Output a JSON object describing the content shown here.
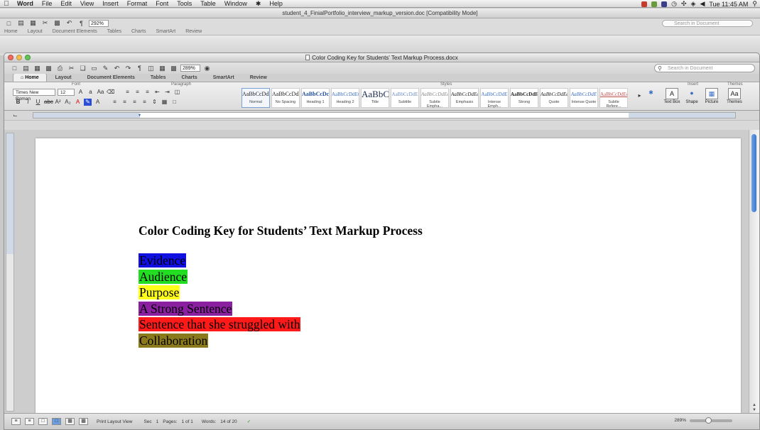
{
  "menubar": {
    "app": "Word",
    "items": [
      "File",
      "Edit",
      "View",
      "Insert",
      "Format",
      "Font",
      "Tools",
      "Table",
      "Window",
      "Help"
    ],
    "clock": "Tue 11:45 AM"
  },
  "background_window": {
    "title": "student_4_FinialPortfolio_interview_markup_version.doc [Compatibility Mode]",
    "zoom": "292%",
    "search_placeholder": "Search in Document",
    "tabs": [
      "Home",
      "Layout",
      "Document Elements",
      "Tables",
      "Charts",
      "SmartArt",
      "Review"
    ]
  },
  "window": {
    "title": "Color Coding Key for Students' Text Markup Process.docx",
    "zoom": "289%",
    "search_placeholder": "Search in Document",
    "tabs": [
      "Home",
      "Layout",
      "Document Elements",
      "Tables",
      "Charts",
      "SmartArt",
      "Review"
    ]
  },
  "ribbon": {
    "groups": {
      "font": "Font",
      "paragraph": "Paragraph",
      "styles": "Styles",
      "insert": "Insert",
      "themes": "Themes"
    },
    "font_name": "Times New Roman",
    "font_size": "12",
    "styles": [
      {
        "sample": "AaBbCcDdE",
        "name": "Normal"
      },
      {
        "sample": "AaBbCcDdE",
        "name": "No Spacing"
      },
      {
        "sample": "AaBbCcDc",
        "name": "Heading 1"
      },
      {
        "sample": "AaBbCcDdEt",
        "name": "Heading 2"
      },
      {
        "sample": "AaBbC",
        "name": "Title"
      },
      {
        "sample": "AaBbCcDdE",
        "name": "Subtitle"
      },
      {
        "sample": "AaBbCcDdEe",
        "name": "Subtle Empha..."
      },
      {
        "sample": "AaBbCcDdEe",
        "name": "Emphasis"
      },
      {
        "sample": "AaBbCcDdE",
        "name": "Intense Emph..."
      },
      {
        "sample": "AaBbCcDdE",
        "name": "Strong"
      },
      {
        "sample": "AaBbCcDdEe",
        "name": "Quote"
      },
      {
        "sample": "AaBbCcDdE",
        "name": "Intense Quote"
      },
      {
        "sample": "AaBbCcDdEe",
        "name": "Subtle Refere..."
      }
    ],
    "insert": [
      "Text Box",
      "Shape",
      "Picture"
    ],
    "themes": "Themes"
  },
  "document": {
    "title": "Color Coding Key for Students’ Text Markup Process",
    "key": [
      {
        "label": "Evidence",
        "color": "#1010e0"
      },
      {
        "label": "Audience",
        "color": "#22dd22"
      },
      {
        "label": "Purpose",
        "color": "#ffff1a"
      },
      {
        "label": "A Strong Sentence",
        "color": "#8a1fa0"
      },
      {
        "label": "Sentence that she struggled with",
        "color": "#ff1a1a"
      },
      {
        "label": "Collaboration",
        "color": "#8a7a1c"
      }
    ]
  },
  "statusbar": {
    "view": "Print Layout View",
    "sec_label": "Sec",
    "sec": "1",
    "pages_label": "Pages:",
    "pages": "1 of 1",
    "words_label": "Words:",
    "words": "14 of 20",
    "zoom": "289%"
  }
}
